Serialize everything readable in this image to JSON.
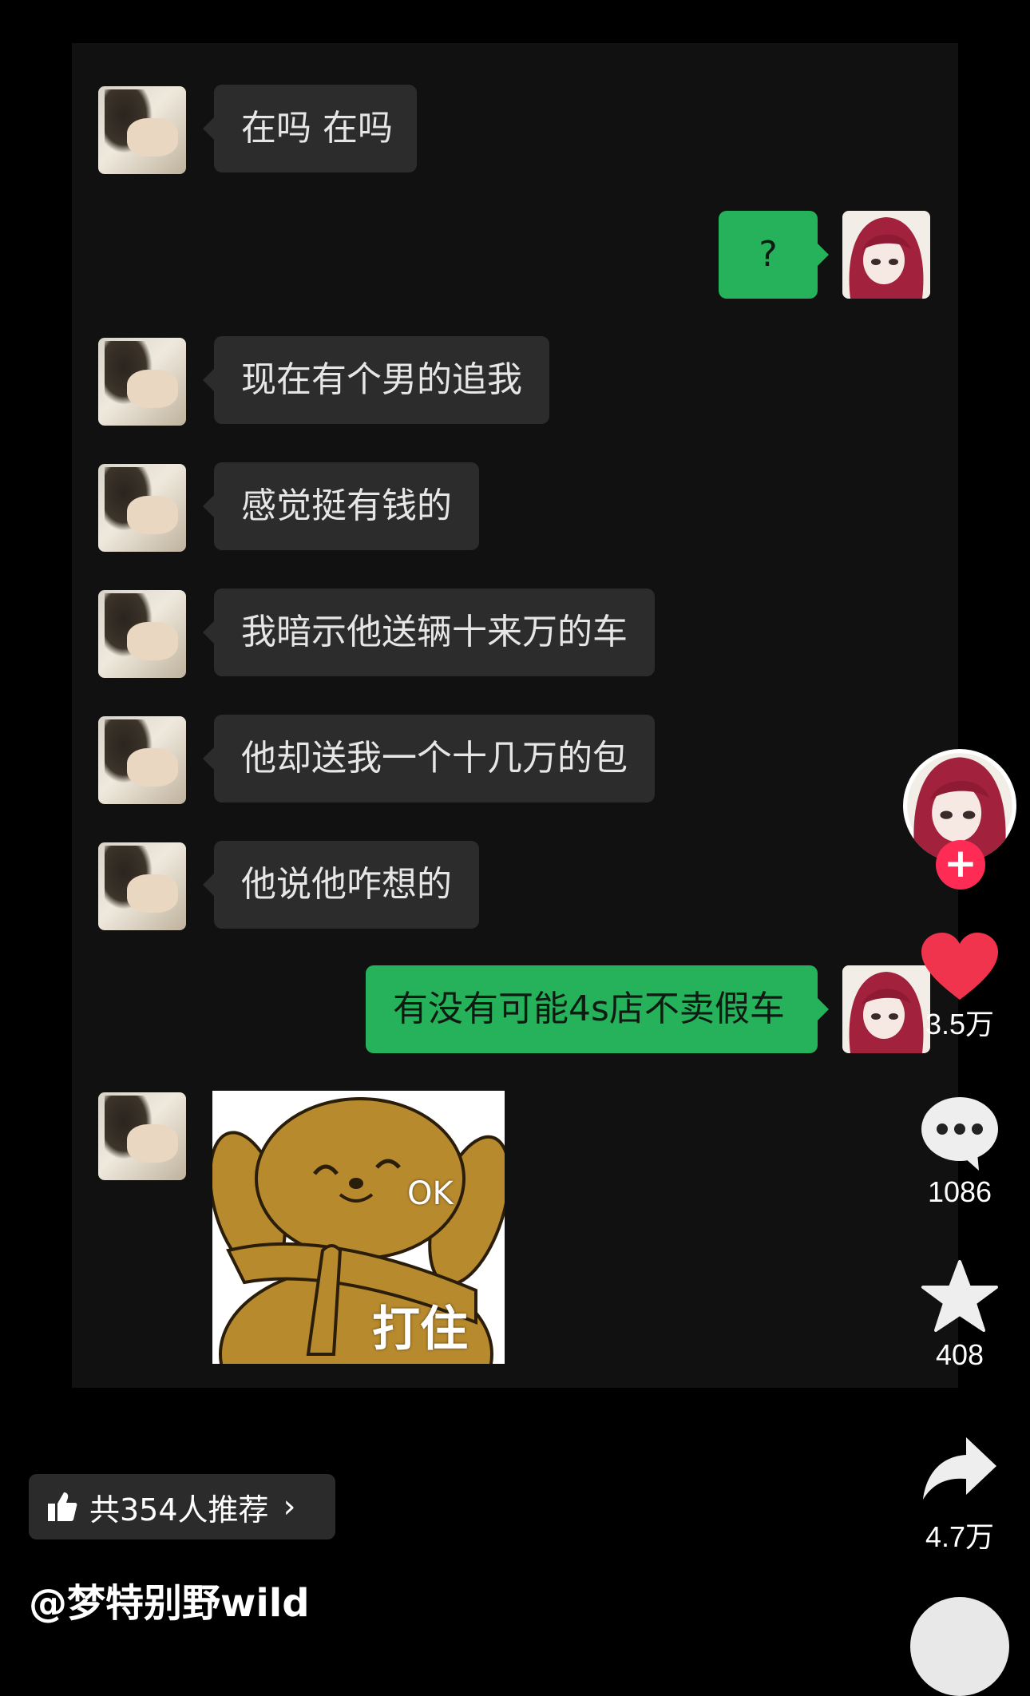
{
  "messages": [
    {
      "from": "friend",
      "text": "在吗 在吗"
    },
    {
      "from": "me",
      "text": "?"
    },
    {
      "from": "friend",
      "text": "现在有个男的追我"
    },
    {
      "from": "friend",
      "text": "感觉挺有钱的"
    },
    {
      "from": "friend",
      "text": "我暗示他送辆十来万的车"
    },
    {
      "from": "friend",
      "text": "他却送我一个十几万的包"
    },
    {
      "from": "friend",
      "text": "他说他咋想的"
    },
    {
      "from": "me",
      "text": "有没有可能4s店不卖假车"
    }
  ],
  "sticker": {
    "text_ok": "OK",
    "text_main": "打住",
    "icon": "dog-sticker"
  },
  "actions": {
    "likes": "3.5万",
    "comments": "1086",
    "favorites": "408",
    "shares": "4.7万"
  },
  "recommend": {
    "label": "共354人推荐"
  },
  "author": {
    "handle": "@梦特别野wild"
  },
  "colors": {
    "out_bubble": "#25b25a",
    "in_bubble": "#2c2c2c",
    "like": "#f0344e",
    "follow": "#fe2c55"
  }
}
